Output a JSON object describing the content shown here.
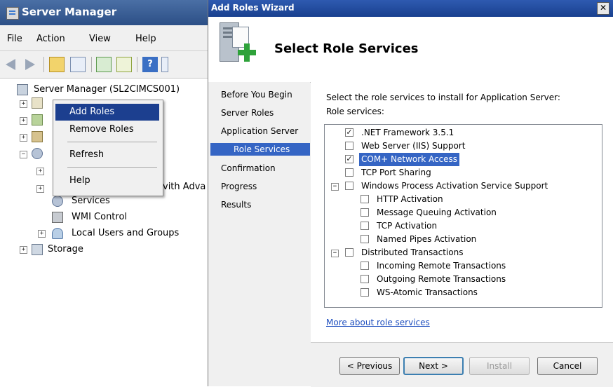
{
  "server_manager": {
    "title": "Server Manager",
    "menu": [
      "File",
      "Action",
      "View",
      "Help"
    ],
    "tree": {
      "root_label": "Server Manager (SL2CIMCS001)",
      "partial_label": "vith Adva",
      "services": "Services",
      "wmi_control": "WMI Control",
      "local_users": "Local Users and Groups",
      "storage": "Storage"
    },
    "context_menu": {
      "add_roles": "Add Roles",
      "remove_roles": "Remove Roles",
      "refresh": "Refresh",
      "help": "Help"
    },
    "toolbar_icons": [
      "back-icon",
      "forward-icon",
      "up-folder-icon",
      "show-hide-icon",
      "refresh-icon",
      "export-icon",
      "help-icon"
    ]
  },
  "wizard": {
    "title": "Add Roles Wizard",
    "close_glyph": "✕",
    "heading": "Select Role Services",
    "nav": {
      "before": "Before You Begin",
      "server_roles": "Server Roles",
      "app_server": "Application Server",
      "role_services": "Role Services",
      "confirmation": "Confirmation",
      "progress": "Progress",
      "results": "Results"
    },
    "instruction": "Select the role services to install for Application Server:",
    "list_label": "Role services:",
    "role_services": [
      {
        "label": ".NET Framework 3.5.1",
        "checked": true
      },
      {
        "label": "Web Server (IIS) Support",
        "checked": false
      },
      {
        "label": "COM+ Network Access",
        "checked": true,
        "selected": true
      },
      {
        "label": "TCP Port Sharing",
        "checked": false
      },
      {
        "label": "Windows Process Activation Service Support",
        "checked": false,
        "expanded": true
      },
      {
        "label": "HTTP Activation",
        "checked": false
      },
      {
        "label": "Message Queuing Activation",
        "checked": false
      },
      {
        "label": "TCP Activation",
        "checked": false
      },
      {
        "label": "Named Pipes Activation",
        "checked": false
      },
      {
        "label": "Distributed Transactions",
        "checked": false,
        "expanded": true
      },
      {
        "label": "Incoming Remote Transactions",
        "checked": false
      },
      {
        "label": "Outgoing Remote Transactions",
        "checked": false
      },
      {
        "label": "WS-Atomic Transactions",
        "checked": false
      }
    ],
    "more_link": "More about role services",
    "buttons": {
      "previous": "< Previous",
      "next": "Next >",
      "install": "Install",
      "cancel": "Cancel"
    },
    "colors": {
      "selection": "#3565c4",
      "title_bar": "#19408f",
      "link": "#1f4fbf"
    }
  }
}
